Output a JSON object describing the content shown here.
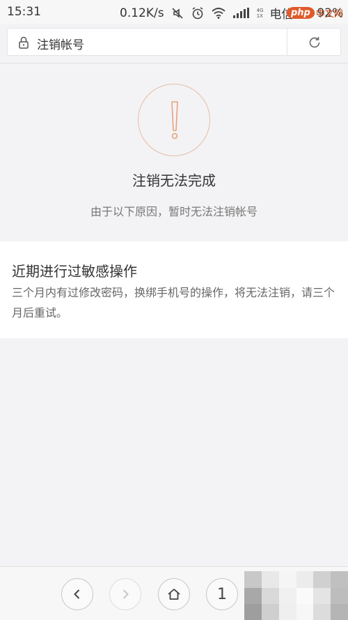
{
  "status_bar": {
    "time": "15:31",
    "net_speed": "0.12K/s",
    "net_type_top": "4G",
    "net_type_bottom": "1X",
    "carrier": "电信",
    "battery": "92%",
    "battery_level": 0.92,
    "icons": [
      "mute-icon",
      "alarm-icon",
      "wifi-icon",
      "signal-icon",
      "battery-icon"
    ]
  },
  "watermark": {
    "badge": "php",
    "text": "中文网"
  },
  "address_bar": {
    "title": "注销帐号",
    "icons": [
      "lock-icon",
      "refresh-icon"
    ]
  },
  "result": {
    "title": "注销无法完成",
    "subtitle": "由于以下原因，暂时无法注销帐号",
    "icon": "exclamation-icon",
    "accent_color": "#e8a27e"
  },
  "reason": {
    "title": "近期进行过敏感操作",
    "description": "三个月内有过修改密码，换绑手机号的操作，将无法注销，请三个月后重试。"
  },
  "bottom_bar": {
    "tab_count": "1",
    "icons": [
      "back-icon",
      "forward-icon",
      "home-icon"
    ]
  }
}
